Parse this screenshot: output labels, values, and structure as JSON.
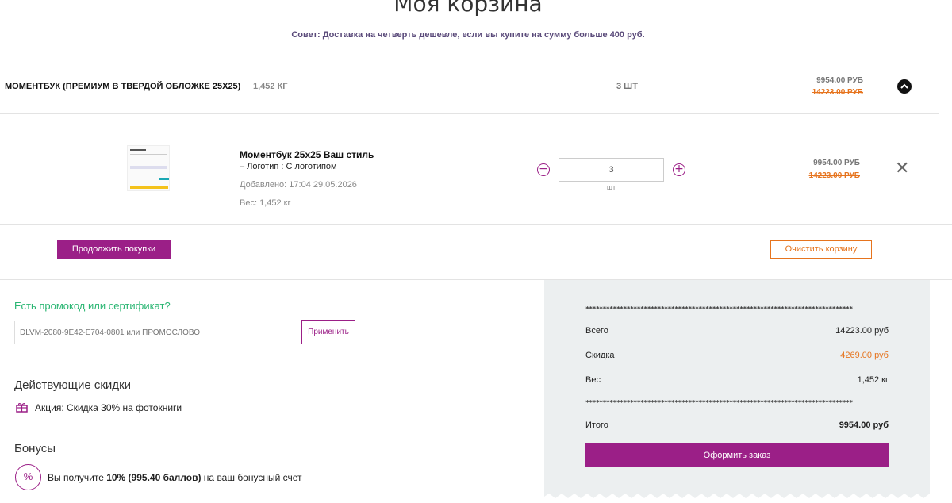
{
  "page": {
    "title": "Моя корзина",
    "tip": "Совет: Доставка на четверть дешевле, если вы купите на сумму больше 400 руб."
  },
  "summary": {
    "name": "МОМЕНТБУК (ПРЕМИУМ В ТВЕРДОЙ ОБЛОЖКЕ 25Х25)",
    "weight": "1,452 КГ",
    "qty": "3 ШТ",
    "price_now": "9954.00 РУБ",
    "price_old": "14223.00 РУБ",
    "collapse_icon": "chevron-up-icon"
  },
  "item": {
    "title": "Моментбук 25х25 Ваш стиль",
    "subtitle": "– Логотип : С логотипом",
    "added": "Добавлено: 17:04 29.05.2026",
    "weight": "Вес: 1,452 кг",
    "qty_value": "3",
    "qty_unit": "шт",
    "minus_label": "−",
    "plus_label": "+",
    "price_now": "9954.00 РУБ",
    "price_old": "14223.00 РУБ",
    "remove_label": "✕"
  },
  "actions": {
    "continue_label": "Продолжить покупки",
    "clear_label": "Очистить корзину"
  },
  "promo": {
    "title": "Есть промокод или сертификат?",
    "placeholder": "DLVM-2080-9E42-E704-0801 или ПРОМОСЛОВО",
    "apply_label": "Применить"
  },
  "discounts": {
    "title": "Действующие скидки",
    "items": [
      {
        "text": "Акция: Скидка 30% на фотокниги",
        "icon": "gift-icon"
      }
    ]
  },
  "bonus": {
    "title": "Бонусы",
    "icon_label": "%",
    "text_before": "Вы получите ",
    "text_bold": "10% (995.40 баллов)",
    "text_after": " на ваш бонусный счет"
  },
  "receipt": {
    "stars": "******************************************************************************",
    "total_label": "Всего",
    "total_value": "14223.00 руб",
    "discount_label": "Скидка",
    "discount_value": "4269.00 руб",
    "weight_label": "Вес",
    "weight_value": "1,452 кг",
    "sum_label": "Итого",
    "sum_value": "9954.00 руб",
    "checkout_label": "Оформить заказ"
  },
  "colors": {
    "accent": "#9b1f87",
    "orange": "#e6741e",
    "green": "#2bb673",
    "receipt_bg": "#eceff0"
  }
}
